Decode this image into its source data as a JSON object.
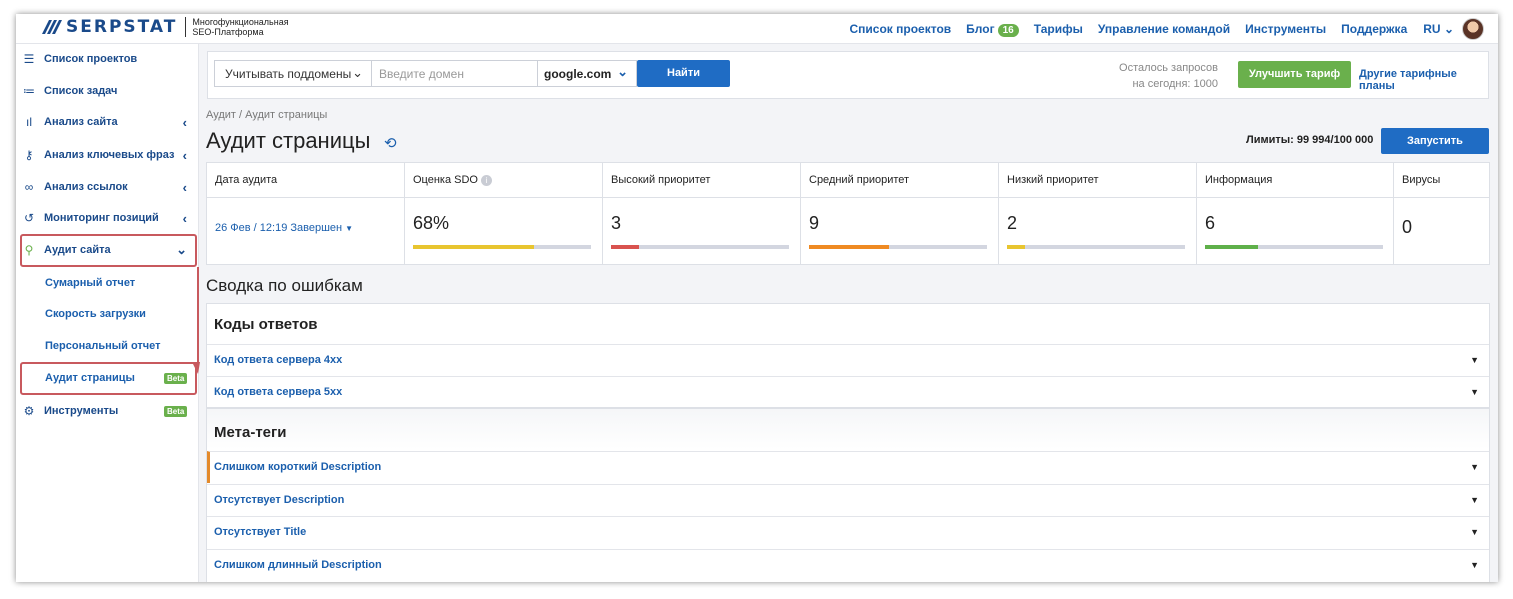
{
  "header": {
    "logo": "SERPSTAT",
    "logo_sub_1": "Многофункциональная",
    "logo_sub_2": "SEO-Платформа",
    "nav": [
      "Список проектов",
      "Блог",
      "Тарифы",
      "Управление командой",
      "Инструменты",
      "Поддержка"
    ],
    "blog_badge": "16",
    "lang": "RU"
  },
  "sidebar": {
    "items": [
      {
        "icon": "list-icon",
        "label": "Список проектов"
      },
      {
        "icon": "task-list-icon",
        "label": "Список задач"
      },
      {
        "icon": "chart-icon",
        "label": "Анализ сайта"
      },
      {
        "icon": "key-icon",
        "label": "Анализ ключевых фраз"
      },
      {
        "icon": "link-icon",
        "label": "Анализ ссылок"
      },
      {
        "icon": "history-icon",
        "label": "Мониторинг позиций"
      },
      {
        "icon": "sitemap-icon",
        "label": "Аудит сайта"
      }
    ],
    "sub_items": [
      "Сумарный отчет",
      "Скорость загрузки",
      "Персональный отчет",
      "Аудит страницы"
    ],
    "tools_label": "Инструменты",
    "beta": "Beta"
  },
  "search": {
    "subdomains": "Учитывать поддомены",
    "domain_placeholder": "Введите домен",
    "engine": "google.com",
    "find_button": "Найти",
    "requests_line1": "Осталось запросов",
    "requests_line2": "на сегодня: 1000",
    "upgrade_button": "Улучшить тариф",
    "other_plans": "Другие тарифные планы"
  },
  "page": {
    "breadcrumb": "Аудит / Аудит страницы",
    "title": "Аудит страницы",
    "limits": "Лимиты: 99 994/100 000",
    "run_button": "Запустить"
  },
  "stats": {
    "date_header": "Дата аудита",
    "date_value": "26 Фев / 12:19 Завершен",
    "cards": [
      {
        "header": "Оценка SDO",
        "value": "68%",
        "fill": 0.68,
        "color": "#e8c52f"
      },
      {
        "header": "Высокий приоритет",
        "value": "3",
        "fill": 0.16,
        "color": "#d9534f"
      },
      {
        "header": "Средний приоритет",
        "value": "9",
        "fill": 0.45,
        "color": "#ef8a22"
      },
      {
        "header": "Низкий приоритет",
        "value": "2",
        "fill": 0.1,
        "color": "#e8c52f"
      },
      {
        "header": "Информация",
        "value": "6",
        "fill": 0.3,
        "color": "#5fb04a"
      }
    ],
    "virus_header": "Вирусы",
    "virus_value": "0"
  },
  "summary": {
    "title": "Сводка по ошибкам",
    "response_codes": {
      "title": "Коды ответов",
      "rows": [
        "Код ответа сервера 4xx",
        "Код ответа сервера 5xx"
      ]
    },
    "meta_tags": {
      "title": "Мета-теги",
      "rows": [
        "Слишком короткий Description",
        "Отсутствует Description",
        "Отсутствует Title",
        "Слишком длинный Description"
      ]
    }
  }
}
